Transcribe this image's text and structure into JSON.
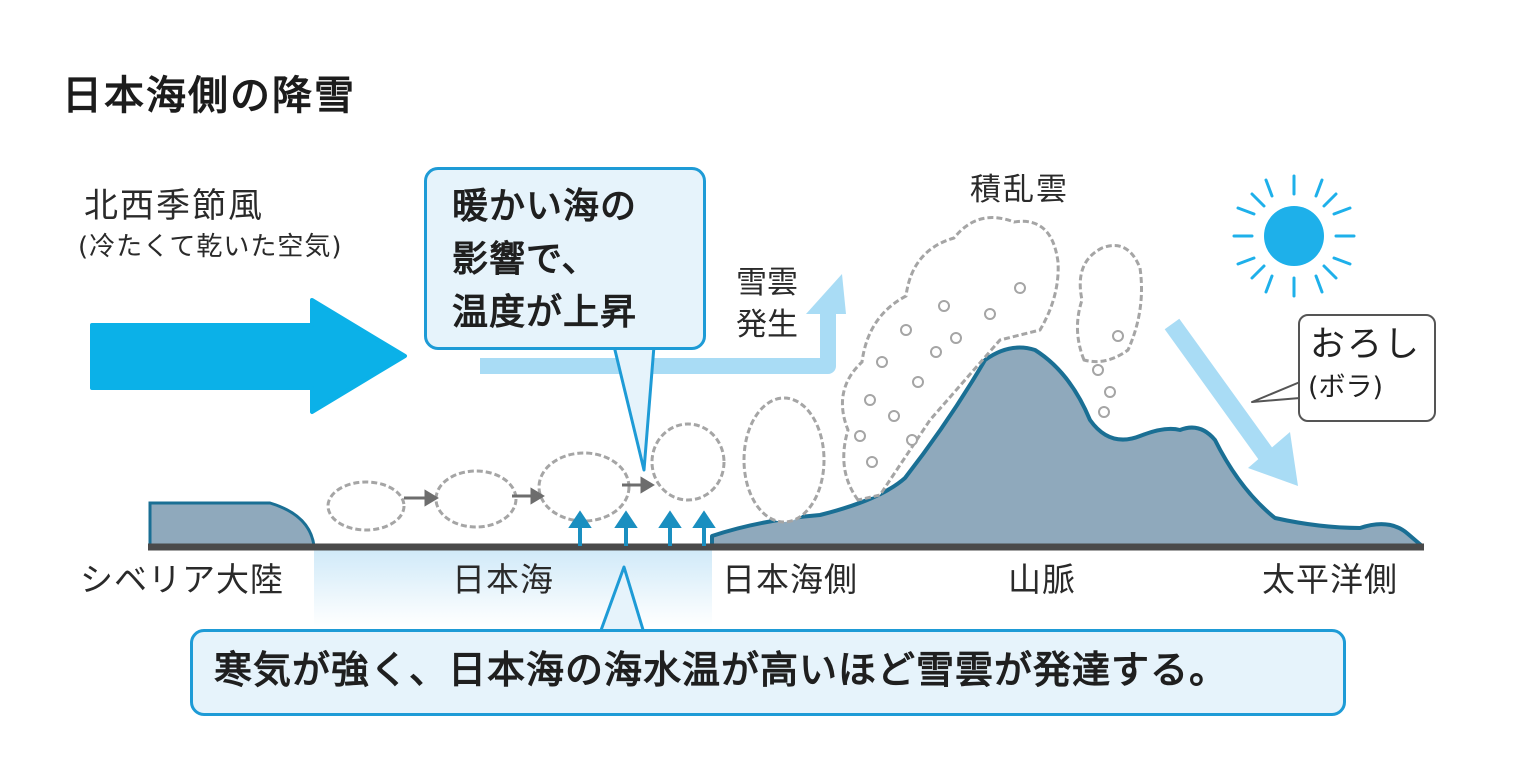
{
  "title": "日本海側の降雪",
  "wind": {
    "label": "北西季節風",
    "note": "(冷たくて乾いた空気)"
  },
  "callout_warm_sea": {
    "text": "暖かい海の\n影響で、\n温度が上昇"
  },
  "snow_cloud": {
    "text": "雪雲\n発生"
  },
  "cumulonimbus": {
    "label": "積乱雲"
  },
  "foehn": {
    "label": "おろし",
    "note": "(ボラ)"
  },
  "ground_labels": {
    "siberia": "シベリア大陸",
    "sea": "日本海",
    "coast": "日本海側",
    "mountains": "山脈",
    "pacific": "太平洋側"
  },
  "summary": {
    "text": "寒気が強く、日本海の海水温が高いほど雪雲が発達する。"
  },
  "colors": {
    "wind_arrow": "#0bb1e8",
    "light_arrow": "#a9dcf5",
    "sun": "#1eb0ea",
    "mountain": "#8fa9bc",
    "mountain_outline": "#1a6f94",
    "callout_fill": "#e6f3fb",
    "callout_border": "#1e9bd6",
    "cloud_outline": "#a5a5a5",
    "ground": "#4a4a4a"
  }
}
